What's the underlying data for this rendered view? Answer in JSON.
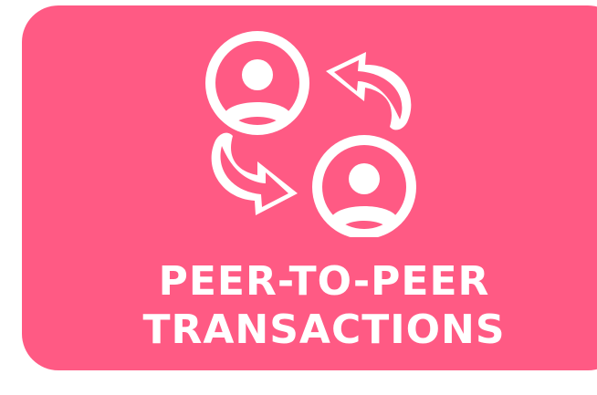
{
  "card": {
    "background_color": "#ff5a84",
    "foreground_color": "#ffffff",
    "icon": "peer-to-peer-exchange-icon",
    "title_lines": [
      "PEER-TO-PEER",
      "TRANSACTIONS"
    ]
  }
}
